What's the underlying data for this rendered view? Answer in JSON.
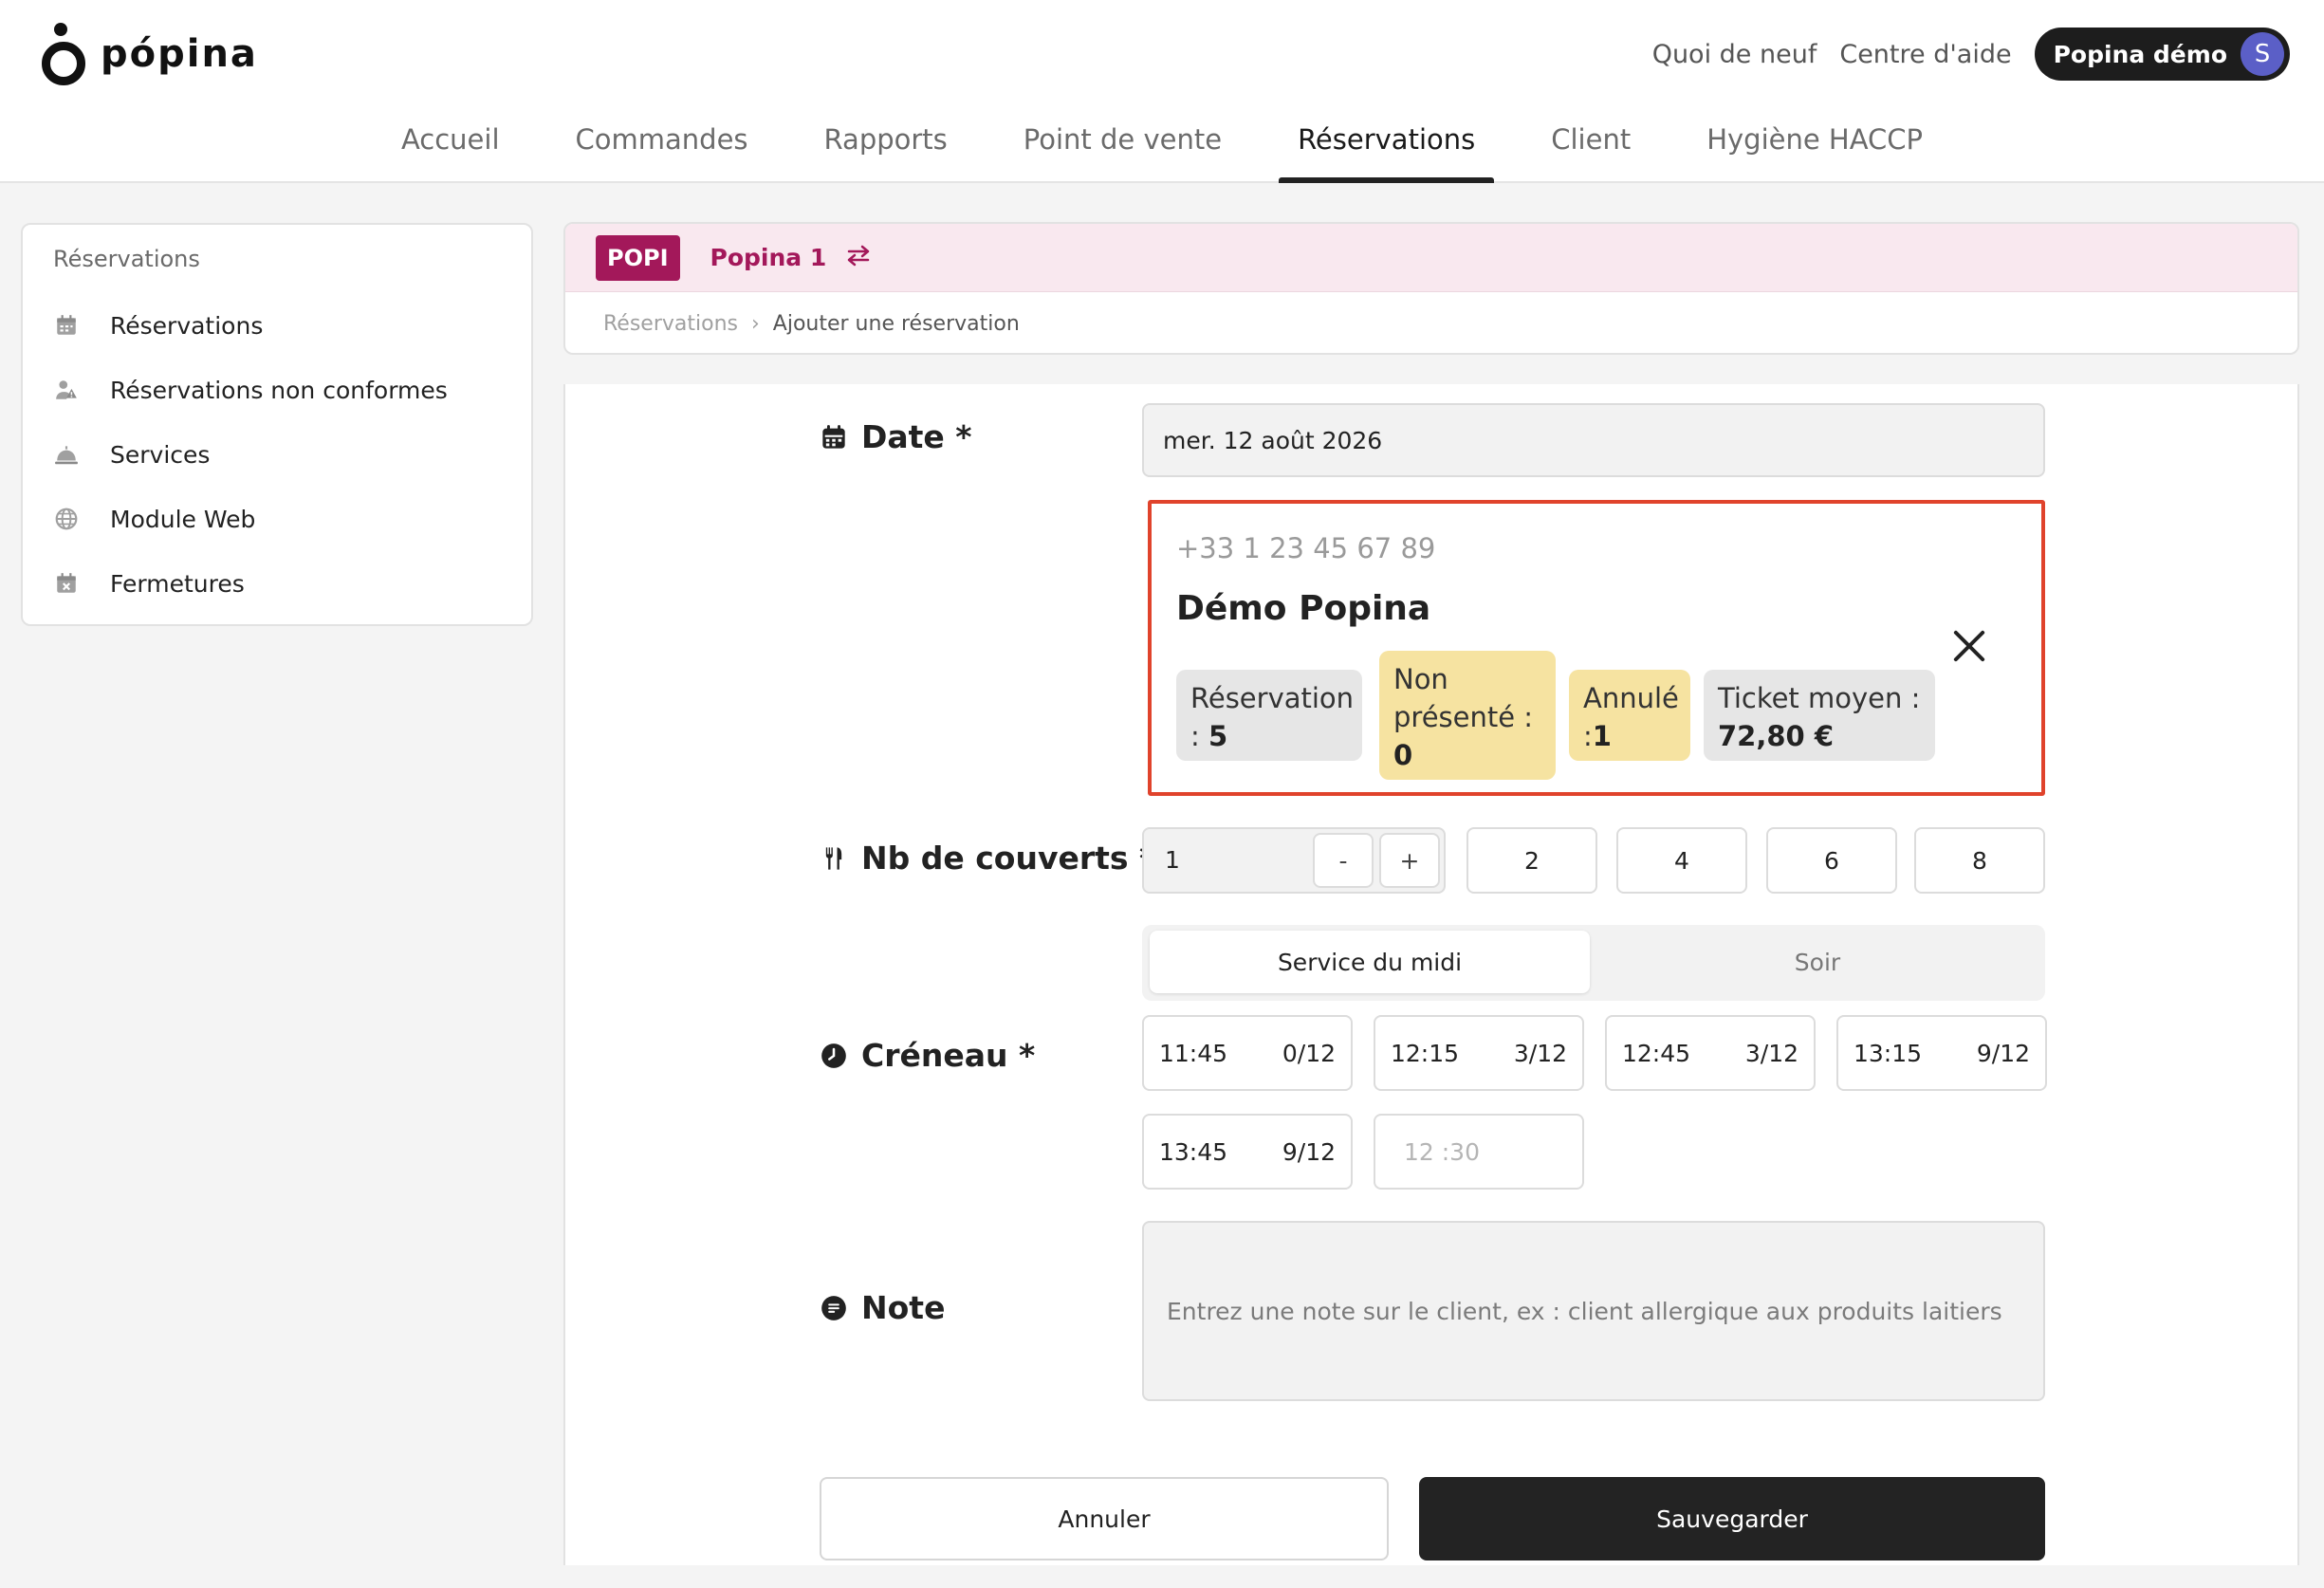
{
  "app": {
    "brand": "pópina",
    "accent_color": "#a3185a",
    "highlight_border_color": "#e0432c"
  },
  "header": {
    "links": [
      "Quoi de neuf",
      "Centre d'aide"
    ],
    "user_name": "Popina démo",
    "user_initial": "S"
  },
  "nav": {
    "items": [
      "Accueil",
      "Commandes",
      "Rapports",
      "Point de vente",
      "Réservations",
      "Client",
      "Hygiène HACCP"
    ],
    "active": "Réservations"
  },
  "sidebar": {
    "title": "Réservations",
    "items": [
      {
        "label": "Réservations",
        "icon": "calendar-icon"
      },
      {
        "label": "Réservations non conformes",
        "icon": "warning-person-icon"
      },
      {
        "label": "Services",
        "icon": "service-bell-icon"
      },
      {
        "label": "Module Web",
        "icon": "globe-icon"
      },
      {
        "label": "Fermetures",
        "icon": "calendar-x-icon"
      }
    ]
  },
  "banner": {
    "badge": "POPI",
    "restaurant": "Popina 1",
    "switch_icon": "swap-arrows-icon"
  },
  "breadcrumb": {
    "parent": "Réservations",
    "current": "Ajouter une réservation"
  },
  "form": {
    "date": {
      "label": "Date *",
      "value": "mer. 12 août 2026"
    },
    "client": {
      "phone": "+33 1 23 45 67 89",
      "name": "Démo Popina",
      "stats": [
        {
          "label": "Réservation",
          "sep": ":",
          "value": "5",
          "style": "grey"
        },
        {
          "label": "Non présenté :",
          "value": "0",
          "style": "yellow"
        },
        {
          "label": "Annulé",
          "sep": ":",
          "value": "1",
          "style": "yellow"
        },
        {
          "label": "Ticket moyen :",
          "value": "72,80 €",
          "style": "grey"
        }
      ]
    },
    "covers": {
      "label": "Nb de couverts *",
      "value": "1",
      "minus": "-",
      "plus": "+",
      "quick": [
        "2",
        "4",
        "6",
        "8"
      ]
    },
    "service": {
      "options": [
        "Service du midi",
        "Soir"
      ],
      "selected": "Service du midi"
    },
    "slot": {
      "label": "Créneau *",
      "slots": [
        {
          "time": "11:45",
          "count": "0/12"
        },
        {
          "time": "12:15",
          "count": "3/12"
        },
        {
          "time": "12:45",
          "count": "3/12"
        },
        {
          "time": "13:15",
          "count": "9/12"
        },
        {
          "time": "13:45",
          "count": "9/12"
        }
      ],
      "custom_placeholder": "12 :30"
    },
    "note": {
      "label": "Note",
      "placeholder": "Entrez une note sur le client, ex : client allergique aux produits laitiers"
    },
    "actions": {
      "cancel": "Annuler",
      "save": "Sauvegarder"
    }
  }
}
